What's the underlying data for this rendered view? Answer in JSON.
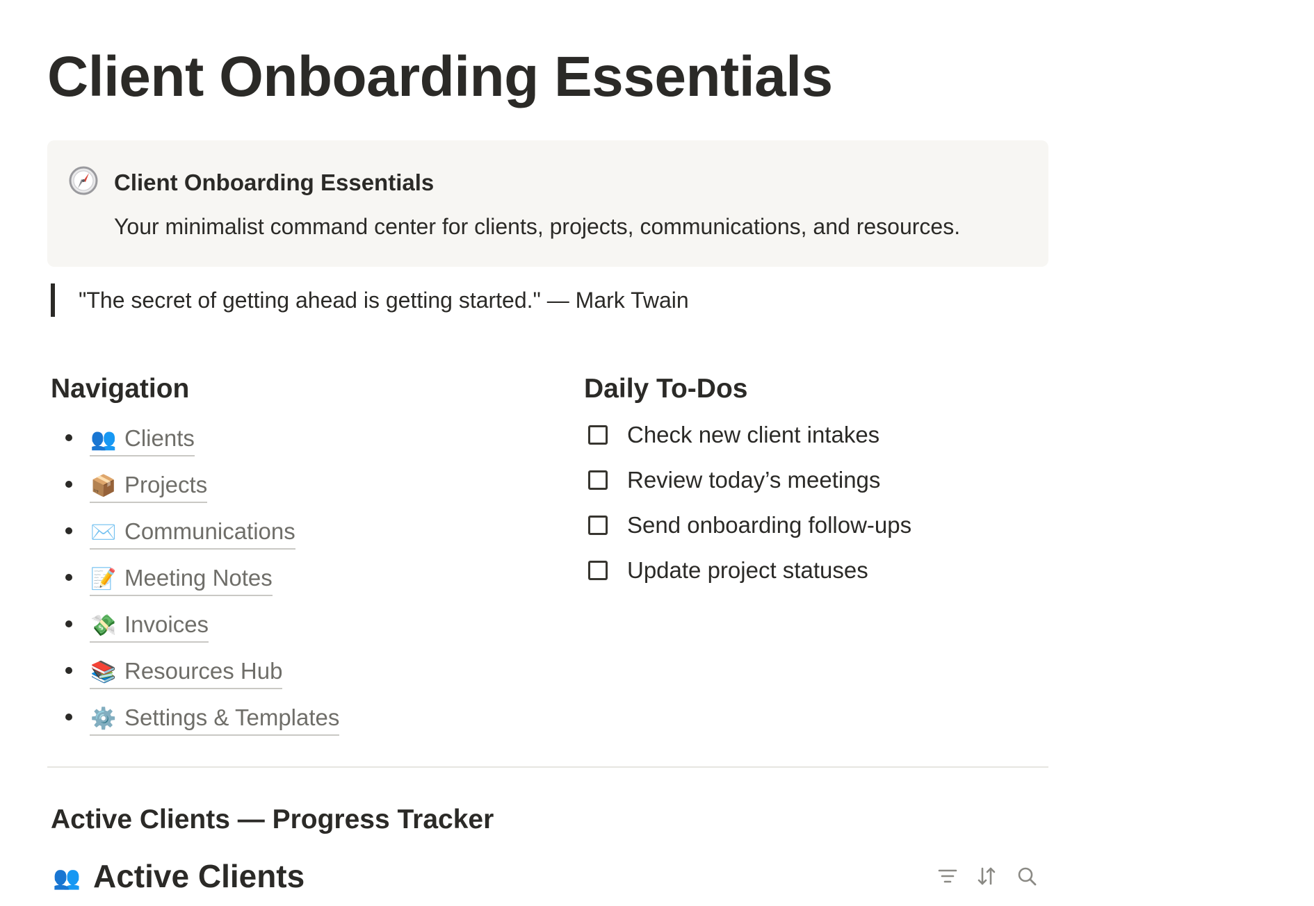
{
  "page": {
    "title": "Client Onboarding Essentials"
  },
  "callout": {
    "icon": "compass-icon",
    "title": "Client Onboarding Essentials",
    "body": "Your minimalist command center for clients, projects, communications, and resources."
  },
  "quote": {
    "text": "\"The secret of getting ahead is getting started.\" — Mark Twain"
  },
  "navigation": {
    "heading": "Navigation",
    "items": [
      {
        "emoji": "👥",
        "icon": "people-icon",
        "label": "Clients"
      },
      {
        "emoji": "📦",
        "icon": "package-icon",
        "label": "Projects"
      },
      {
        "emoji": "✉️",
        "icon": "envelope-icon",
        "label": "Communications"
      },
      {
        "emoji": "📝",
        "icon": "memo-icon",
        "label": "Meeting Notes"
      },
      {
        "emoji": "💸",
        "icon": "money-wings-icon",
        "label": "Invoices"
      },
      {
        "emoji": "📚",
        "icon": "books-icon",
        "label": "Resources Hub"
      },
      {
        "emoji": "⚙️",
        "icon": "gear-icon",
        "label": "Settings & Templates"
      }
    ]
  },
  "todos": {
    "heading": "Daily To-Dos",
    "items": [
      {
        "label": "Check new client intakes",
        "checked": false
      },
      {
        "label": "Review today’s meetings",
        "checked": false
      },
      {
        "label": "Send onboarding follow-ups",
        "checked": false
      },
      {
        "label": "Update project statuses",
        "checked": false
      }
    ]
  },
  "tracker": {
    "heading": "Active Clients — Progress Tracker",
    "database": {
      "emoji": "👥",
      "icon": "people-icon",
      "title": "Active Clients",
      "tools": [
        "filter-icon",
        "sort-icon",
        "search-icon"
      ]
    }
  }
}
